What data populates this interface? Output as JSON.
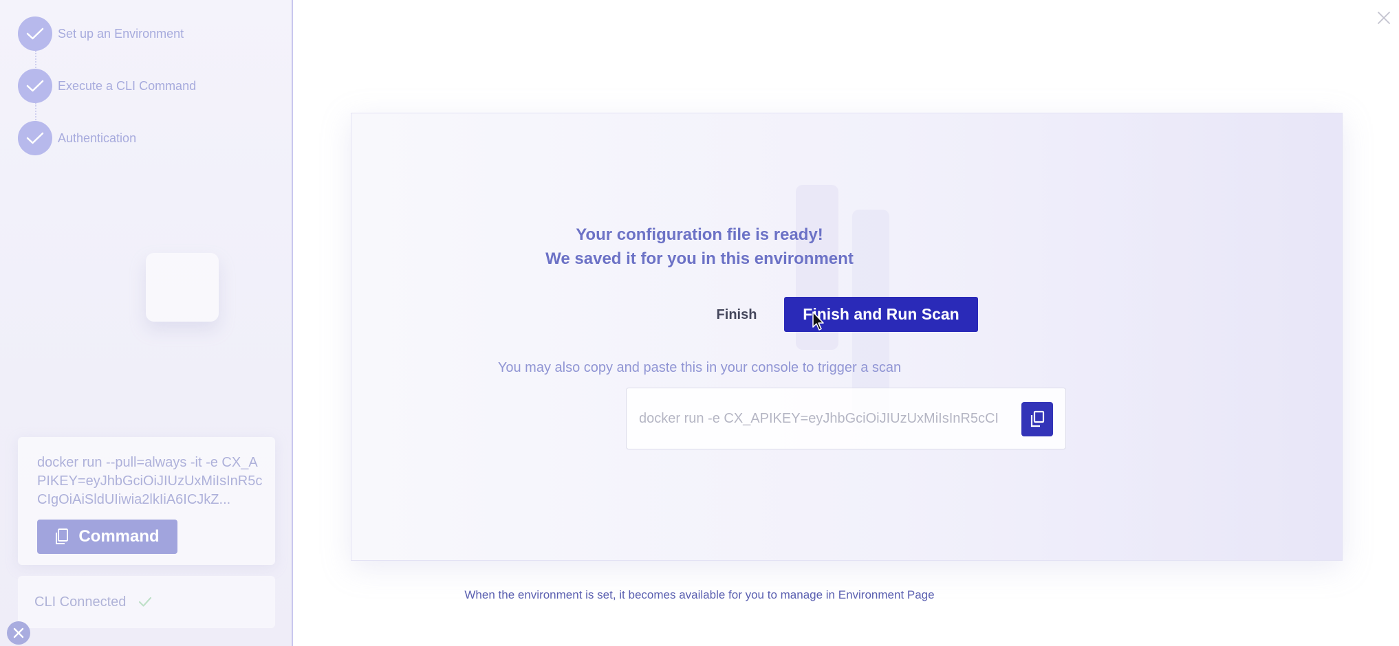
{
  "sidebar": {
    "steps": [
      {
        "label": "Set up an Environment",
        "done": true
      },
      {
        "label": "Execute a CLI Command",
        "done": true
      },
      {
        "label": "Authentication",
        "done": true
      }
    ],
    "command_card": {
      "command_text": "docker run --pull=always -it -e CX_APIKEY=eyJhbGciOiJIUzUxMiIsInR5cCIgOiAiSldUIiwia2lkIiA6ICJkZ...",
      "button_label": "Command",
      "button_icon": "copy-icon"
    },
    "cli_status": {
      "label": "CLI Connected",
      "icon": "check-icon"
    }
  },
  "main": {
    "headline_line1": "Your configuration file is ready!",
    "headline_line2": "We saved it for you in this environment",
    "finish_label": "Finish",
    "finish_run_label": "Finish and Run Scan",
    "copy_hint": "You may also copy and paste this in your console to trigger a scan",
    "command_value": "docker run -e CX_APIKEY=eyJhbGciOiJIUzUxMiIsInR5cCI",
    "footer_note": "When the environment is set, it becomes available for you to manage in Environment Page"
  },
  "colors": {
    "primary": "#2a2ab8",
    "step_done": "#b7b9ec",
    "headline": "#6c72c6"
  }
}
